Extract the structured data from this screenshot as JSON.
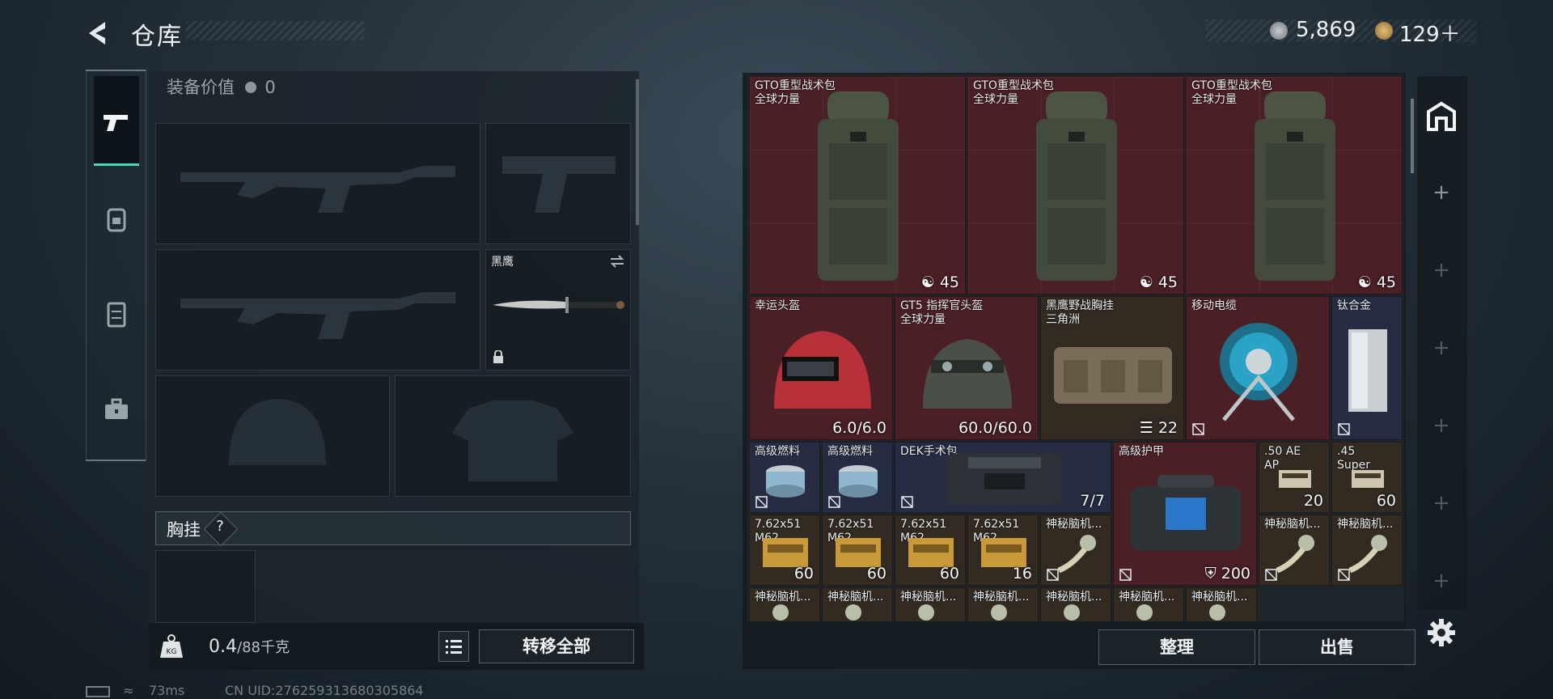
{
  "header": {
    "title": "仓库",
    "silver": "5,869",
    "gold": "129＋"
  },
  "left_rail": {
    "items": [
      "weapon-tab",
      "backpack-tab",
      "armor-tab",
      "case-tab"
    ]
  },
  "equipment": {
    "value_label": "装备价值",
    "value": "0",
    "knife_name": "黑鹰",
    "chest_label": "胸挂",
    "chest_hint": "?",
    "weight_current": "0.4",
    "weight_max": "/88千克",
    "transfer_all": "转移全部"
  },
  "inventory": {
    "items": [
      {
        "name": "GTO重型战术包",
        "sub": "全球力量",
        "count": "45"
      },
      {
        "name": "GTO重型战术包",
        "sub": "全球力量",
        "count": "45"
      },
      {
        "name": "GTO重型战术包",
        "sub": "全球力量",
        "count": "45"
      },
      {
        "name": "幸运头盔",
        "sub": "",
        "count": "6.0/6.0"
      },
      {
        "name": "GT5 指挥官头盔",
        "sub": "全球力量",
        "count": "60.0/60.0"
      },
      {
        "name": "黑鹰野战胸挂",
        "sub": "三角洲",
        "count": "22"
      },
      {
        "name": "移动电缆",
        "sub": "",
        "count": ""
      },
      {
        "name": "钛合金",
        "sub": "",
        "count": ""
      },
      {
        "name": "高级燃料",
        "sub": "",
        "count": ""
      },
      {
        "name": "高级燃料",
        "sub": "",
        "count": ""
      },
      {
        "name": "DEK手术包",
        "sub": "",
        "count": "7/7"
      },
      {
        "name": "高级护甲",
        "sub": "",
        "count": "200"
      },
      {
        "name": ".50 AE",
        "sub": "AP",
        "count": "20"
      },
      {
        "name": ".45",
        "sub": "Super",
        "count": "60"
      },
      {
        "name": "7.62x51",
        "sub": "M62",
        "count": "60"
      },
      {
        "name": "7.62x51",
        "sub": "M62",
        "count": "60"
      },
      {
        "name": "7.62x51",
        "sub": "M62",
        "count": "60"
      },
      {
        "name": "7.62x51",
        "sub": "M62",
        "count": "16"
      },
      {
        "name": "神秘脑机...",
        "sub": "",
        "count": ""
      },
      {
        "name": "神秘脑机...",
        "sub": "",
        "count": ""
      },
      {
        "name": "神秘脑机...",
        "sub": "",
        "count": ""
      },
      {
        "name": "神秘脑机...",
        "sub": "",
        "count": ""
      },
      {
        "name": "神秘脑机...",
        "sub": "",
        "count": ""
      },
      {
        "name": "神秘脑机...",
        "sub": "",
        "count": ""
      },
      {
        "name": "神秘脑机...",
        "sub": "",
        "count": ""
      },
      {
        "name": "神秘脑机...",
        "sub": "",
        "count": ""
      },
      {
        "name": "神秘脑机...",
        "sub": "",
        "count": ""
      },
      {
        "name": "神秘脑机...",
        "sub": "",
        "count": ""
      }
    ],
    "sort": "整理",
    "sell": "出售"
  },
  "status_bar": {
    "ping": "73ms",
    "uid": "CN UID:276259313680305864"
  },
  "colors": {
    "accent": "#4fd4b8",
    "red_item": "#4a1f25",
    "gold_item": "#332b22"
  }
}
